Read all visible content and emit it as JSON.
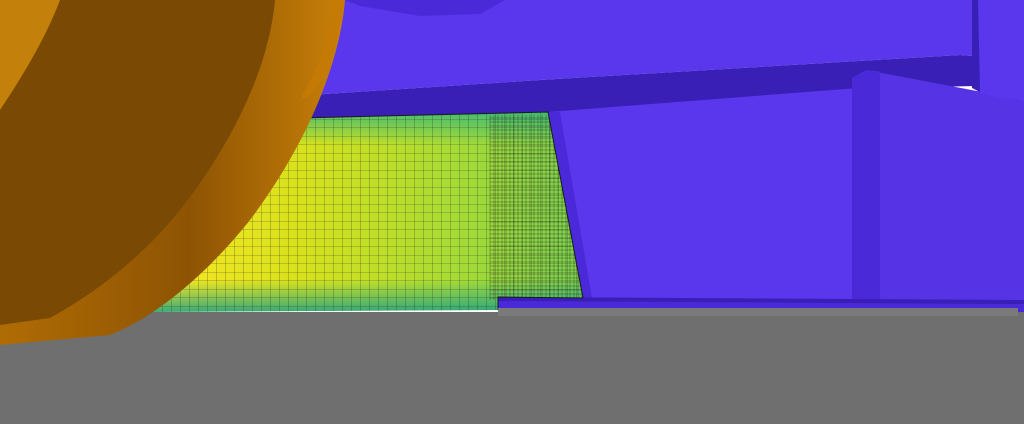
{
  "scene": {
    "colors": {
      "background": "#ffffff",
      "ground": "#6f6f6f",
      "body_light": "#5a36ec",
      "body_mid": "#4a2ad8",
      "body_dark": "#3a1fb6",
      "body_shadow": "#2e1796",
      "wheel_outer": "#c57a05",
      "wheel_inner": "#7a4903",
      "wheel_mid": "#9c5e04",
      "mesh_line": "#1b1b1b",
      "field_colormap": [
        "#35b779",
        "#6ece58",
        "#b5de2b",
        "#fde725"
      ]
    }
  }
}
